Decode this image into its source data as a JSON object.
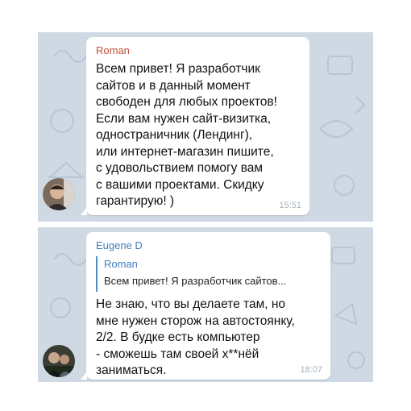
{
  "colors": {
    "chat_background": "#ced9e4",
    "bubble": "#ffffff",
    "sender_roman": "#c0513e",
    "sender_eugene": "#3f7fbf",
    "reply_bar": "#4e8fc8",
    "time_text": "#a6b2bd"
  },
  "messages": [
    {
      "sender": "Roman",
      "text": "Всем привет! Я разработчик\nсайтов и в данный момент\nсвободен для любых проектов!\nЕсли вам нужен сайт-визитка,\nодностраничник (Лендинг),\nили интернет-магазин пишите,\nс удовольствием помогу вам\nс вашими проектами. Скидку\nгарантирую! )",
      "time": "15:51",
      "avatar": "user-photo-avatar"
    },
    {
      "sender": "Eugene D",
      "reply": {
        "sender": "Roman",
        "text": "Всем привет! Я разработчик сайтов..."
      },
      "text": "Не знаю, что вы делаете там, но\nмне нужен сторож на автостоянку,\n2/2. В будке есть компьютер\n- сможешь там своей х**нёй\nзаниматься.",
      "time": "18:07",
      "avatar": "user-photo-avatar"
    }
  ]
}
